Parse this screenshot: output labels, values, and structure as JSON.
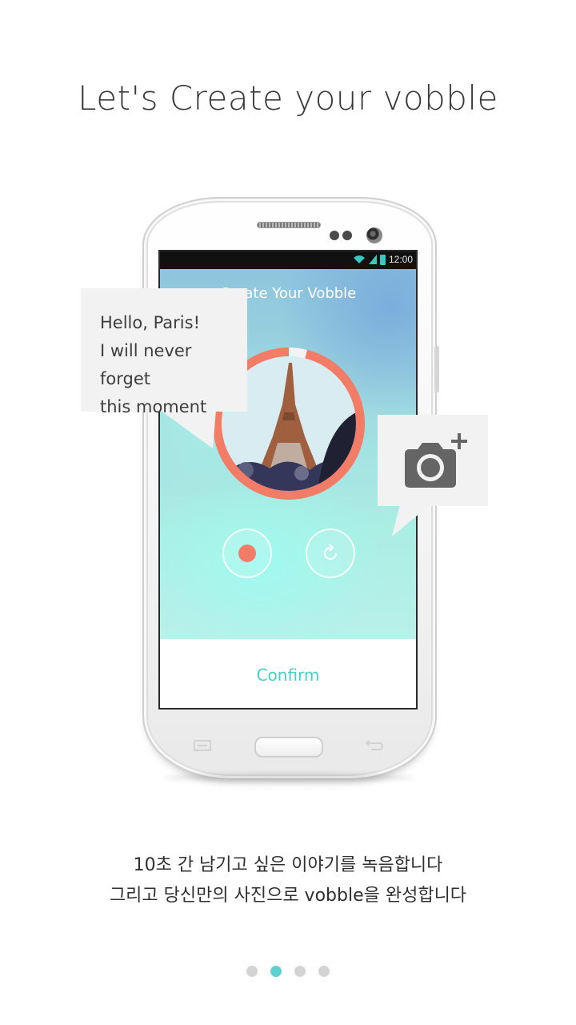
{
  "headline": "Let's Create your vobble",
  "phone": {
    "status_time": "12:00",
    "app_title": "Create Your Vobble",
    "confirm_label": "Confirm",
    "record_progress": 0.96
  },
  "speech_bubble": {
    "lines": [
      "Hello, Paris!",
      "I will never forget",
      "this moment"
    ]
  },
  "camera_bubble": {
    "icon": "camera-plus-icon"
  },
  "description": {
    "line1": "10초 간 남기고 싶은 이야기를 녹음합니다",
    "line2": "그리고 당신만의 사진으로 vobble을 완성합니다"
  },
  "pager": {
    "total": 4,
    "active_index": 1
  },
  "colors": {
    "accent_coral": "#f27c66",
    "accent_teal": "#43cfc4",
    "pager_active": "#5fd0d0"
  }
}
